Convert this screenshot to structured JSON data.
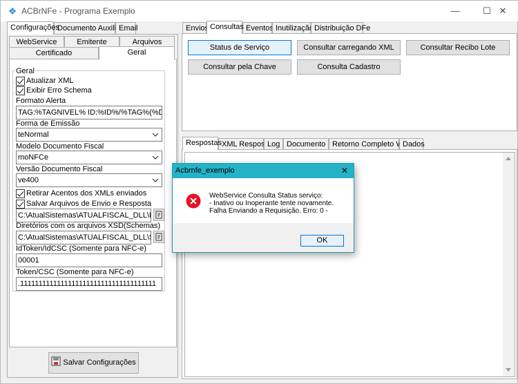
{
  "window": {
    "title": "ACBrNFe - Programa Exemplo",
    "minimize_glyph": "—",
    "maximize_glyph": "☐",
    "close_glyph": "✕"
  },
  "left_tabs": {
    "row1": [
      "Configurações",
      "Documento Auxiliar",
      "Email"
    ],
    "row2": [
      "WebService",
      "Emitente",
      "Arquivos"
    ],
    "row3": [
      "Certificado",
      "Geral"
    ]
  },
  "geral": {
    "group_title": "Geral",
    "atualizar_xml": "Atualizar XML",
    "exibir_erro_schema": "Exibir Erro Schema",
    "formato_alerta_label": "Formato Alerta",
    "formato_alerta_value": "TAG:%TAGNIVEL% ID:%ID%/%TAG%(%DESCRI",
    "forma_emissao_label": "Forma de Emissão",
    "forma_emissao_value": "teNormal",
    "modelo_label": "Modelo Documento Fiscal",
    "modelo_value": "moNFCe",
    "versao_label": "Versão Documento Fiscal",
    "versao_value": "ve400",
    "retirar_acentos": "Retirar Acentos dos XMLs enviados",
    "salvar_arquivos": "Salvar Arquivos de Envio e Resposta",
    "path_retornos": "C:\\AtualSistemas\\ATUALFISCAL_DLL\\Retornos",
    "diretorios_label": "Diretórios com os arquivos XSD(Schemas)",
    "path_schemas": "C:\\AtualSistemas\\ATUALFISCAL_DLL\\SCHEMAS",
    "idtoken_label": "IdToken/IdCSC (Somente para NFC-e)",
    "idtoken_value": "00001",
    "token_label": "Token/CSC (Somente para NFC-e)",
    "token_value": ".1111111111111111111111111111111111111"
  },
  "save_button": "Salvar Configurações",
  "right_tabs": [
    "Envios",
    "Consultas",
    "Eventos",
    "Inutilização",
    "Distribuição DFe"
  ],
  "consultas_buttons": {
    "status_servico": "Status de Serviço",
    "consultar_carregando_xml": "Consultar carregando XML",
    "consultar_recibo_lote": "Consultar Recibo Lote",
    "consultar_pela_chave": "Consultar pela Chave",
    "consulta_cadastro": "Consulta Cadastro"
  },
  "bottom_tabs": [
    "Respostas",
    "XML Resposta",
    "Log",
    "Documento",
    "Retorno Completo WS",
    "Dados"
  ],
  "dialog": {
    "title": "Acbrnfe_exemplo",
    "close_glyph": "✕",
    "line1": "WebService Consulta Status serviço:",
    "line2": "- Inativo ou Inoperante tente novamente.",
    "line3": "Falha Enviando a Requisição. Erro: 0 -",
    "ok_label": "OK"
  },
  "colors": {
    "dialog_title_bar": "#25b2c6",
    "error_icon": "#e81123",
    "focus_border": "#0078d7"
  }
}
